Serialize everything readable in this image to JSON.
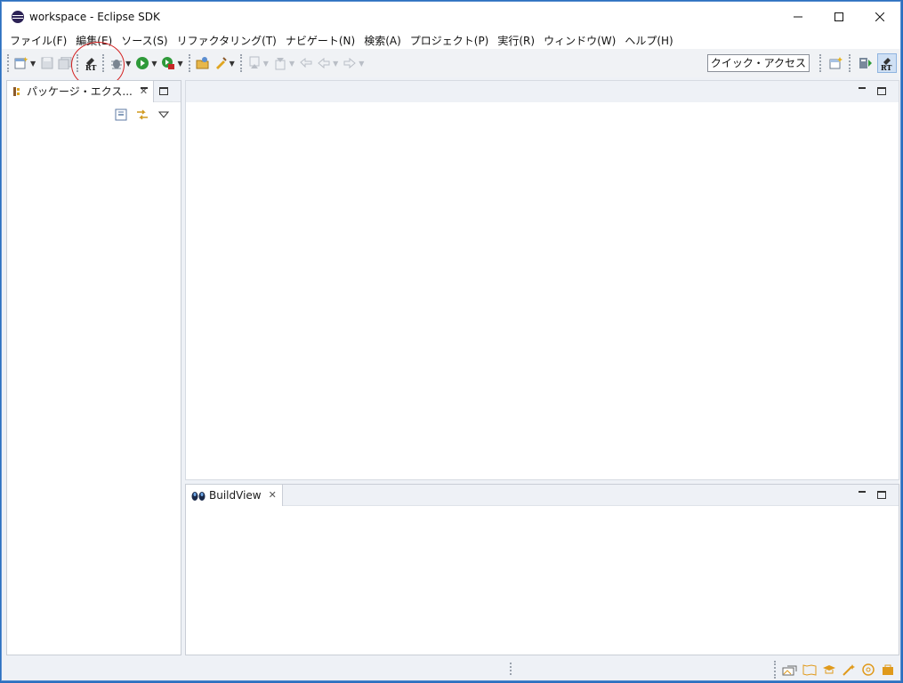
{
  "window": {
    "title": "workspace - Eclipse SDK",
    "controls": {
      "minimize": "—",
      "maximize": "☐",
      "close": "✕"
    }
  },
  "menubar": {
    "items": [
      "ファイル(F)",
      "編集(E)",
      "ソース(S)",
      "リファクタリング(T)",
      "ナビゲート(N)",
      "検索(A)",
      "プロジェクト(P)",
      "実行(R)",
      "ウィンドウ(W)",
      "ヘルプ(H)"
    ]
  },
  "toolbar": {
    "rt_label": "RT",
    "quick_access": "クイック・アクセス",
    "icons": [
      "new-wizard-icon",
      "save-icon",
      "save-all-icon",
      "rt-tool-icon",
      "debug-icon",
      "run-icon",
      "external-tools-icon",
      "open-type-icon",
      "search-icon",
      "next-annotation-icon",
      "previous-annotation-icon",
      "last-edit-icon",
      "back-icon",
      "forward-icon",
      "open-perspective-icon",
      "java-perspective-icon",
      "rt-perspective-icon"
    ]
  },
  "package_explorer": {
    "tab_label": "パッケージ・エクス...",
    "close": "✕"
  },
  "build_view": {
    "tab_label": "BuildView",
    "close": "✕"
  },
  "colors": {
    "accent": "#2a6fbf",
    "highlight_ring": "#d42020",
    "status_icons": "#e09a1c"
  }
}
